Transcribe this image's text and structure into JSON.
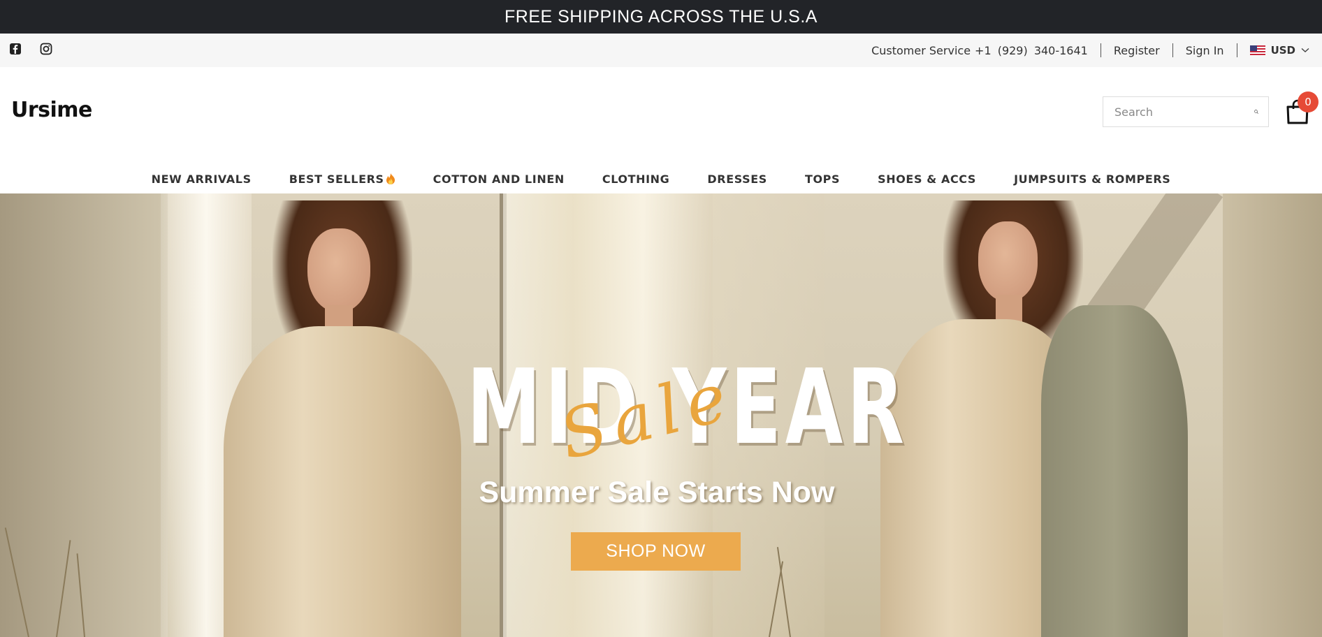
{
  "announcement": {
    "text": "FREE SHIPPING ACROSS THE U.S.A"
  },
  "utility": {
    "customer_service_label": "Customer Service",
    "phone": "+1  (929)  340-1641",
    "register": "Register",
    "sign_in": "Sign In",
    "currency": "USD"
  },
  "header": {
    "logo": "Ursime",
    "search_placeholder": "Search",
    "cart_count": "0"
  },
  "nav": {
    "items": [
      {
        "label": "NEW ARRIVALS"
      },
      {
        "label": "BEST SELLERS"
      },
      {
        "label": "COTTON AND LINEN"
      },
      {
        "label": "CLOTHING"
      },
      {
        "label": "DRESSES"
      },
      {
        "label": "TOPS"
      },
      {
        "label": "SHOES & ACCS"
      },
      {
        "label": "JUMPSUITS & ROMPERS"
      }
    ]
  },
  "hero": {
    "headline": "MID YEAR",
    "script": "Sale",
    "subheadline": "Summer Sale Starts Now",
    "cta": "SHOP NOW"
  },
  "colors": {
    "announcement_bg": "#222428",
    "cta_bg": "#ecaa4e",
    "badge_bg": "#e64a36",
    "script_color": "#e9a53d"
  },
  "icons": [
    "facebook-icon",
    "instagram-icon",
    "us-flag-icon",
    "chevron-down-icon",
    "search-icon",
    "shopping-bag-icon",
    "flame-icon"
  ]
}
